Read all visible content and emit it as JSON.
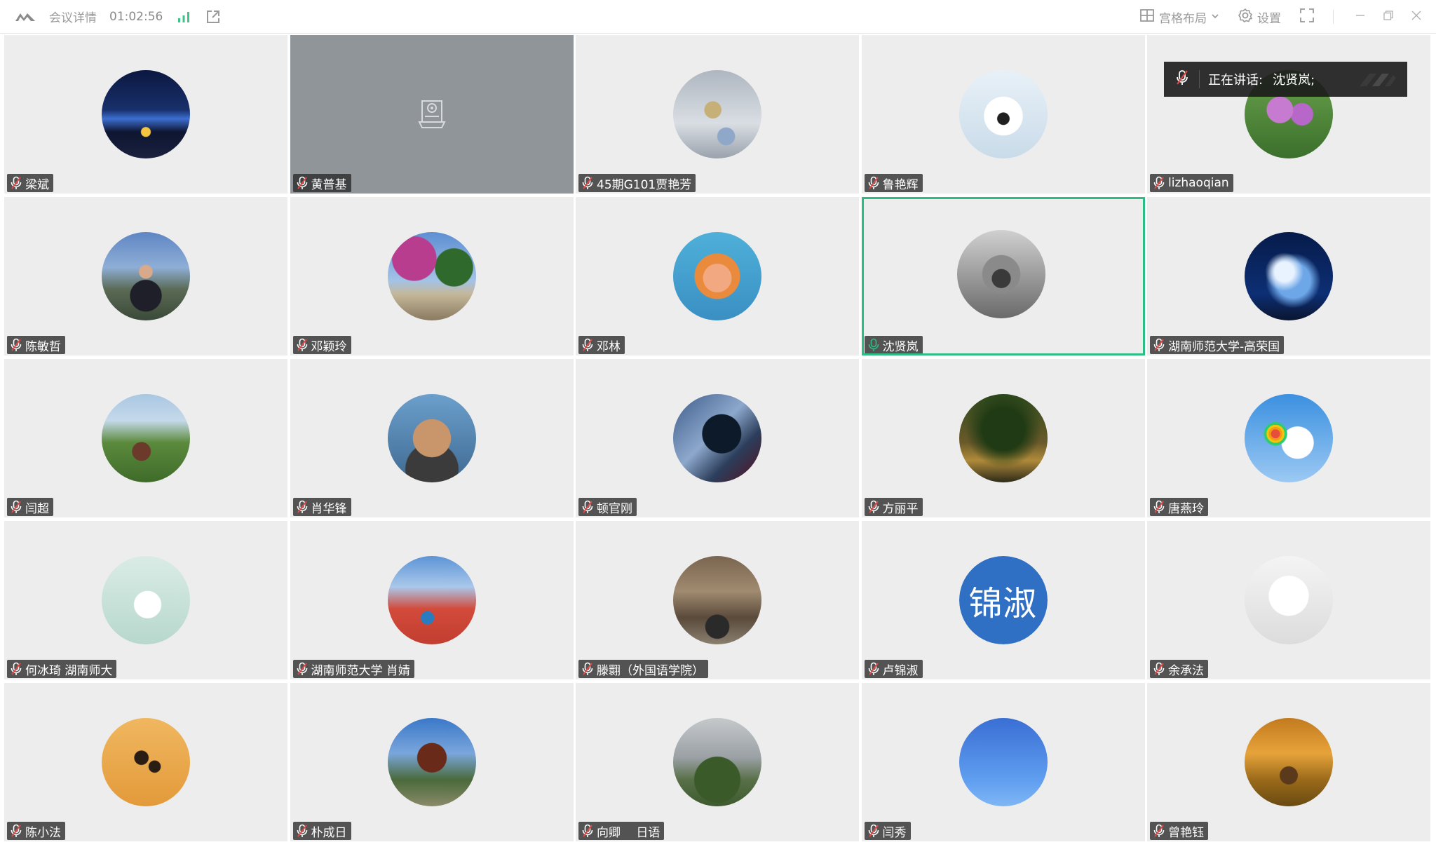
{
  "titlebar": {
    "title": "会议详情",
    "duration": "01:02:56",
    "layout_label": "宫格布局",
    "settings_label": "设置"
  },
  "speaking": {
    "prefix": "正在讲话:",
    "name": "沈贤岚;"
  },
  "participants": [
    {
      "name": "梁斌"
    },
    {
      "name": "黄普基"
    },
    {
      "name": "45期G101贾艳芳"
    },
    {
      "name": "鲁艳辉"
    },
    {
      "name": "lizhaoqian"
    },
    {
      "name": "陈敏哲"
    },
    {
      "name": "邓颖玲"
    },
    {
      "name": "邓林"
    },
    {
      "name": "沈贤岚"
    },
    {
      "name": "湖南师范大学-高荣国"
    },
    {
      "name": "闫超"
    },
    {
      "name": "肖华锋"
    },
    {
      "name": "顿官刚"
    },
    {
      "name": "方丽平"
    },
    {
      "name": "唐燕玲"
    },
    {
      "name": "何冰琦 湖南师大"
    },
    {
      "name": "湖南师范大学 肖婧"
    },
    {
      "name": "滕翾（外国语学院）"
    },
    {
      "name": "卢锦淑",
      "avatar_text": "锦淑"
    },
    {
      "name": "余承法"
    },
    {
      "name": "陈小法"
    },
    {
      "name": "朴成日"
    },
    {
      "name": "向卿　 日语"
    },
    {
      "name": "闫秀"
    },
    {
      "name": "曾艳钰"
    }
  ],
  "colors": {
    "active_border": "#2dbd83",
    "camera_off_bg": "#8f9599",
    "avatar_text_bg": "#2f6fc4"
  }
}
